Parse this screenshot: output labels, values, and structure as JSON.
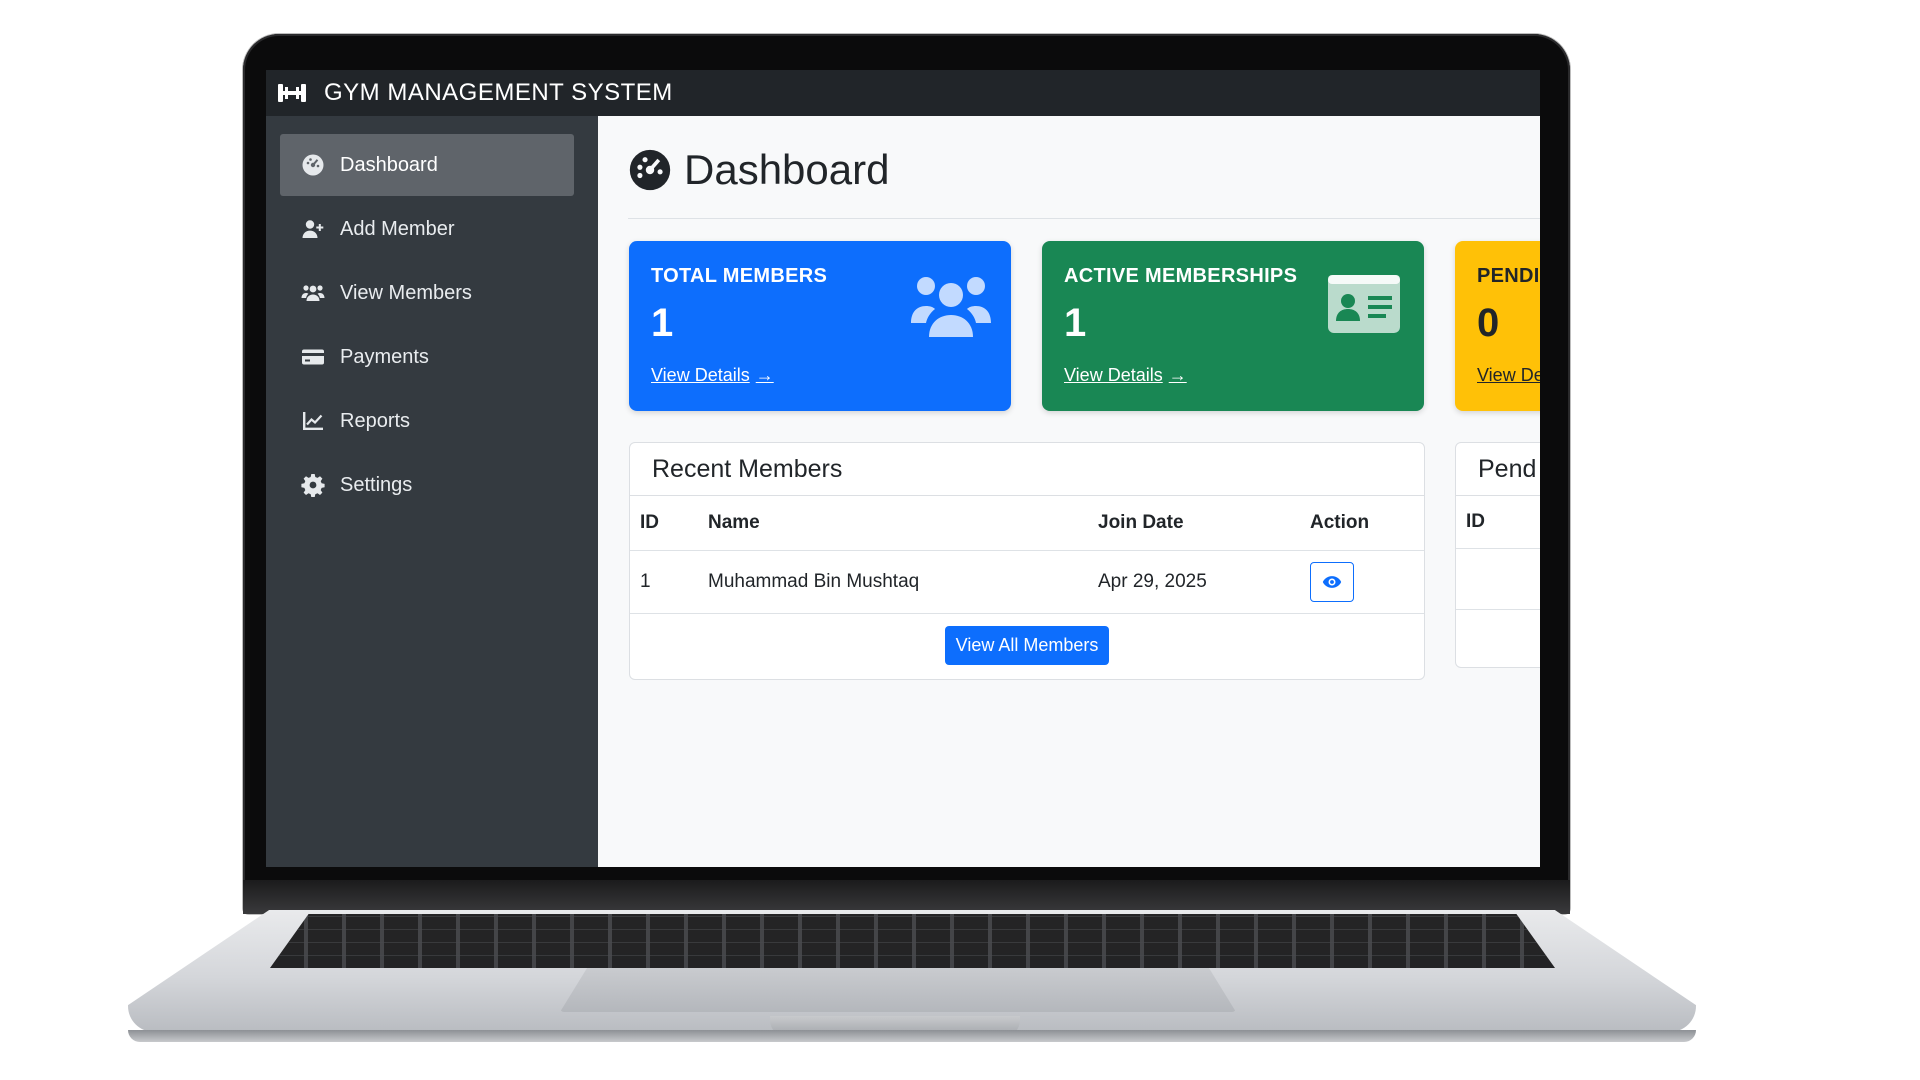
{
  "app": {
    "brand_title": "GYM MANAGEMENT SYSTEM"
  },
  "sidebar": {
    "items": [
      {
        "label": "Dashboard",
        "icon": "dashboard-gauge-icon",
        "active": true
      },
      {
        "label": "Add Member",
        "icon": "user-plus-icon",
        "active": false
      },
      {
        "label": "View Members",
        "icon": "users-icon",
        "active": false
      },
      {
        "label": "Payments",
        "icon": "credit-card-icon",
        "active": false
      },
      {
        "label": "Reports",
        "icon": "line-chart-icon",
        "active": false
      },
      {
        "label": "Settings",
        "icon": "gear-icon",
        "active": false
      }
    ]
  },
  "main": {
    "title": "Dashboard",
    "cards": [
      {
        "label": "TOTAL MEMBERS",
        "value": "1",
        "link": "View Details",
        "color": "#0d6efd",
        "icon": "users-icon"
      },
      {
        "label": "ACTIVE MEMBERSHIPS",
        "value": "1",
        "link": "View Details",
        "color": "#198754",
        "icon": "id-card-icon"
      },
      {
        "label": "PENDI",
        "value": "0",
        "link": "View De",
        "color": "#ffc107"
      }
    ],
    "recent_members": {
      "title": "Recent Members",
      "columns": [
        "ID",
        "Name",
        "Join Date",
        "Action"
      ],
      "rows": [
        {
          "id": "1",
          "name": "Muhammad Bin Mushtaq",
          "join_date": "Apr 29, 2025",
          "action_icon": "eye-icon"
        }
      ],
      "view_all_label": "View All Members"
    },
    "pending_panel": {
      "title": "Pend",
      "columns": [
        "ID"
      ]
    }
  }
}
